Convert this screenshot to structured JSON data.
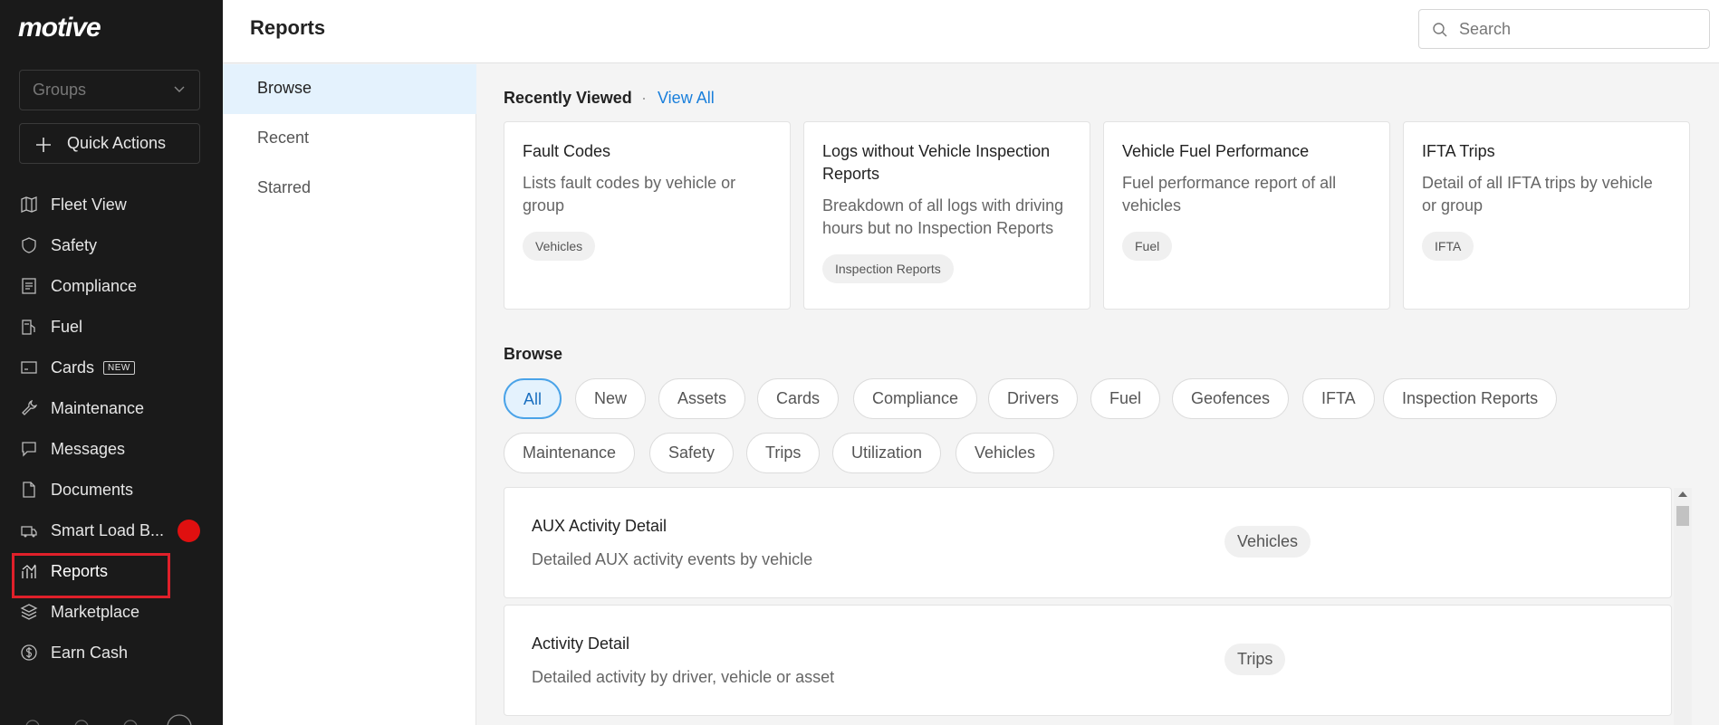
{
  "sidebar": {
    "logo": "motive",
    "groups_placeholder": "Groups",
    "quick_actions": "Quick Actions",
    "items": [
      {
        "label": "Fleet View",
        "icon": "map-icon"
      },
      {
        "label": "Safety",
        "icon": "shield-icon"
      },
      {
        "label": "Compliance",
        "icon": "document-list-icon"
      },
      {
        "label": "Fuel",
        "icon": "fuel-pump-icon"
      },
      {
        "label": "Cards",
        "icon": "card-icon",
        "badge": "NEW"
      },
      {
        "label": "Maintenance",
        "icon": "wrench-icon"
      },
      {
        "label": "Messages",
        "icon": "chat-icon"
      },
      {
        "label": "Documents",
        "icon": "file-icon"
      },
      {
        "label": "Smart Load B...",
        "icon": "truck-load-icon",
        "alert": true
      },
      {
        "label": "Reports",
        "icon": "chart-icon",
        "active": true
      },
      {
        "label": "Marketplace",
        "icon": "layers-icon"
      },
      {
        "label": "Earn Cash",
        "icon": "dollar-icon"
      }
    ]
  },
  "header": {
    "title": "Reports",
    "search_placeholder": "Search"
  },
  "subnav": {
    "items": [
      "Browse",
      "Recent",
      "Starred"
    ],
    "active": "Browse"
  },
  "recently_viewed": {
    "heading": "Recently Viewed",
    "separator": "·",
    "view_all": "View All",
    "cards": [
      {
        "title": "Fault Codes",
        "desc": "Lists fault codes by vehicle or group",
        "tag": "Vehicles"
      },
      {
        "title": "Logs without Vehicle Inspection Reports",
        "desc": "Breakdown of all logs with driving hours but no Inspection Reports",
        "tag": "Inspection Reports"
      },
      {
        "title": "Vehicle Fuel Performance",
        "desc": "Fuel performance report of all vehicles",
        "tag": "Fuel"
      },
      {
        "title": "IFTA Trips",
        "desc": "Detail of all IFTA trips by vehicle or group",
        "tag": "IFTA"
      }
    ]
  },
  "browse": {
    "heading": "Browse",
    "filters": [
      "All",
      "New",
      "Assets",
      "Cards",
      "Compliance",
      "Drivers",
      "Fuel",
      "Geofences",
      "IFTA",
      "Inspection Reports",
      "Maintenance",
      "Safety",
      "Trips",
      "Utilization",
      "Vehicles"
    ],
    "active_filter": "All",
    "reports": [
      {
        "title": "AUX Activity Detail",
        "desc": "Detailed AUX activity events by vehicle",
        "tag": "Vehicles"
      },
      {
        "title": "Activity Detail",
        "desc": "Detailed activity by driver, vehicle or asset",
        "tag": "Trips"
      }
    ]
  }
}
